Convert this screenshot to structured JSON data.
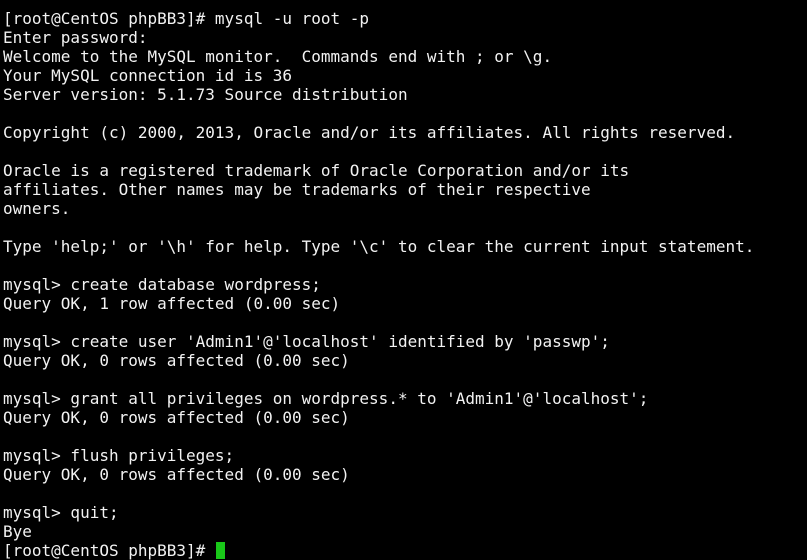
{
  "terminal": {
    "lines": [
      "[root@CentOS phpBB3]# mysql -u root -p",
      "Enter password:",
      "Welcome to the MySQL monitor.  Commands end with ; or \\g.",
      "Your MySQL connection id is 36",
      "Server version: 5.1.73 Source distribution",
      "",
      "Copyright (c) 2000, 2013, Oracle and/or its affiliates. All rights reserved.",
      "",
      "Oracle is a registered trademark of Oracle Corporation and/or its",
      "affiliates. Other names may be trademarks of their respective",
      "owners.",
      "",
      "Type 'help;' or '\\h' for help. Type '\\c' to clear the current input statement.",
      "",
      "mysql> create database wordpress;",
      "Query OK, 1 row affected (0.00 sec)",
      "",
      "mysql> create user 'Admin1'@'localhost' identified by 'passwp';",
      "Query OK, 0 rows affected (0.00 sec)",
      "",
      "mysql> grant all privileges on wordpress.* to 'Admin1'@'localhost';",
      "Query OK, 0 rows affected (0.00 sec)",
      "",
      "mysql> flush privileges;",
      "Query OK, 0 rows affected (0.00 sec)",
      "",
      "mysql> quit;",
      "Bye"
    ],
    "prompt": "[root@CentOS phpBB3]# ",
    "cursor_color": "#19c819",
    "text_color": "#f2f2f2",
    "background_color": "#000000"
  }
}
